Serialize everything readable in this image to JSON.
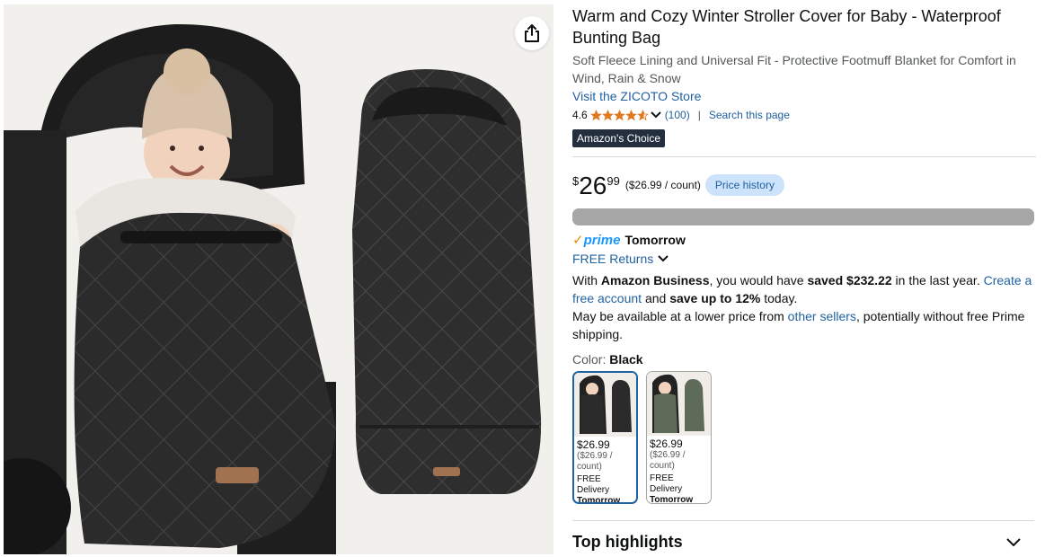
{
  "product": {
    "title": "Warm and Cozy Winter Stroller Cover for Baby - Waterproof Bunting Bag",
    "subtitle": "Soft Fleece Lining and Universal Fit - Protective Footmuff Blanket for Comfort in Wind, Rain & Snow",
    "store_link": "Visit the ZICOTO Store",
    "rating": "4.6",
    "rating_stars": 4.6,
    "review_count": "(100)",
    "search_page": "Search this page",
    "badge": "Amazon's Choice"
  },
  "price": {
    "symbol": "$",
    "whole": "26",
    "fraction": "99",
    "unit_price": "($26.99 / count)",
    "history_button": "Price history"
  },
  "delivery": {
    "prime_check": "✓",
    "prime": "prime",
    "tomorrow": "Tomorrow",
    "free_returns": "FREE Returns"
  },
  "business": {
    "t1": "With ",
    "amazon_business": "Amazon Business",
    "t2": ", you would have ",
    "saved": "saved $232.22",
    "t3": " in the last year. ",
    "create_link": "Create a free account",
    "t4": " and ",
    "save_up": "save up to 12%",
    "t5": " today."
  },
  "lower_price": {
    "t1": "May be available at a lower price from ",
    "link": "other sellers",
    "t2": ", potentially without free Prime shipping."
  },
  "color": {
    "label": "Color: ",
    "value": "Black"
  },
  "swatches": [
    {
      "price": "$26.99",
      "unit": "($26.99 / count)",
      "delivery": "FREE Delivery",
      "when": "Tomorrow"
    },
    {
      "price": "$26.99",
      "unit": "($26.99 / count)",
      "delivery": "FREE Delivery",
      "when": "Tomorrow"
    }
  ],
  "highlights": {
    "title": "Top highlights"
  },
  "colors": {
    "link": "#2162a1",
    "prime_blue": "#1a98ff",
    "star": "#de7921",
    "badge_bg": "#232f3e"
  },
  "icons": [
    "share-icon",
    "star-icon",
    "chevron-down-icon"
  ]
}
